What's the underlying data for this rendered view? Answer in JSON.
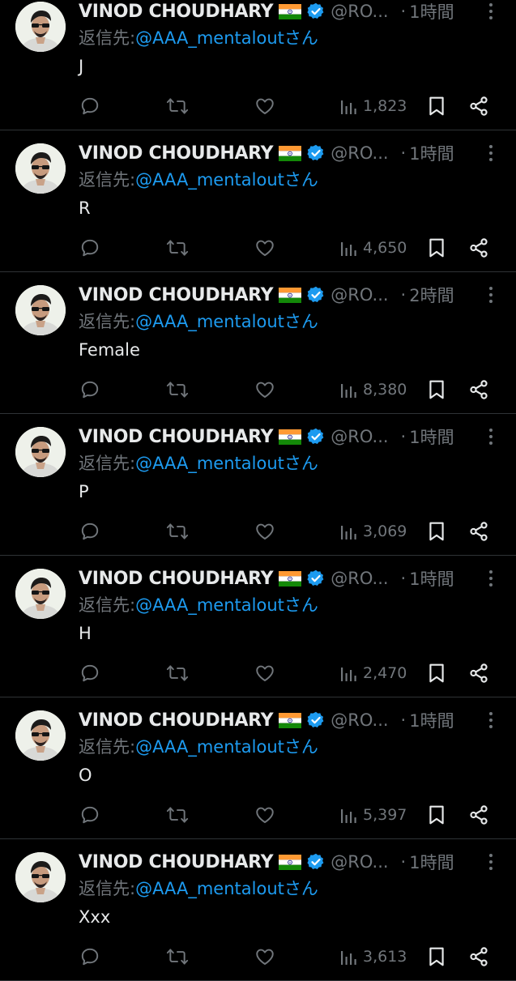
{
  "tweets": [
    {
      "display_name": "VINOD CHOUDHARY",
      "flag": "🇮🇳",
      "handle": "@RO...",
      "separator": "·",
      "time": "1時間",
      "reply_prefix": "返信先: ",
      "reply_to": "@AAA_mentaloutさん",
      "text": "J",
      "views": "1,823"
    },
    {
      "display_name": "VINOD CHOUDHARY",
      "flag": "🇮🇳",
      "handle": "@RO...",
      "separator": "·",
      "time": "1時間",
      "reply_prefix": "返信先: ",
      "reply_to": "@AAA_mentaloutさん",
      "text": "R",
      "views": "4,650"
    },
    {
      "display_name": "VINOD CHOUDHARY",
      "flag": "🇮🇳",
      "handle": "@RO...",
      "separator": "·",
      "time": "2時間",
      "reply_prefix": "返信先: ",
      "reply_to": "@AAA_mentaloutさん",
      "text": "Female",
      "views": "8,380"
    },
    {
      "display_name": "VINOD CHOUDHARY",
      "flag": "🇮🇳",
      "handle": "@RO...",
      "separator": "·",
      "time": "1時間",
      "reply_prefix": "返信先: ",
      "reply_to": "@AAA_mentaloutさん",
      "text": "P",
      "views": "3,069"
    },
    {
      "display_name": "VINOD CHOUDHARY",
      "flag": "🇮🇳",
      "handle": "@RO...",
      "separator": "·",
      "time": "1時間",
      "reply_prefix": "返信先: ",
      "reply_to": "@AAA_mentaloutさん",
      "text": "H",
      "views": "2,470"
    },
    {
      "display_name": "VINOD CHOUDHARY",
      "flag": "🇮🇳",
      "handle": "@RO...",
      "separator": "·",
      "time": "1時間",
      "reply_prefix": "返信先: ",
      "reply_to": "@AAA_mentaloutさん",
      "text": "O",
      "views": "5,397"
    },
    {
      "display_name": "VINOD CHOUDHARY",
      "flag": "🇮🇳",
      "handle": "@RO...",
      "separator": "·",
      "time": "1時間",
      "reply_prefix": "返信先: ",
      "reply_to": "@AAA_mentaloutさん",
      "text": "Xxx",
      "views": "3,613"
    }
  ],
  "icons": {
    "reply": "reply-icon",
    "retweet": "retweet-icon",
    "like": "heart-icon",
    "views": "views-icon",
    "bookmark": "bookmark-icon",
    "share": "share-icon",
    "more": "more-icon",
    "verified": "verified-badge-icon"
  },
  "colors": {
    "background": "#000000",
    "text_primary": "#e7e9ea",
    "text_secondary": "#71767b",
    "link": "#1d9bf0",
    "divider": "#2f3336"
  }
}
